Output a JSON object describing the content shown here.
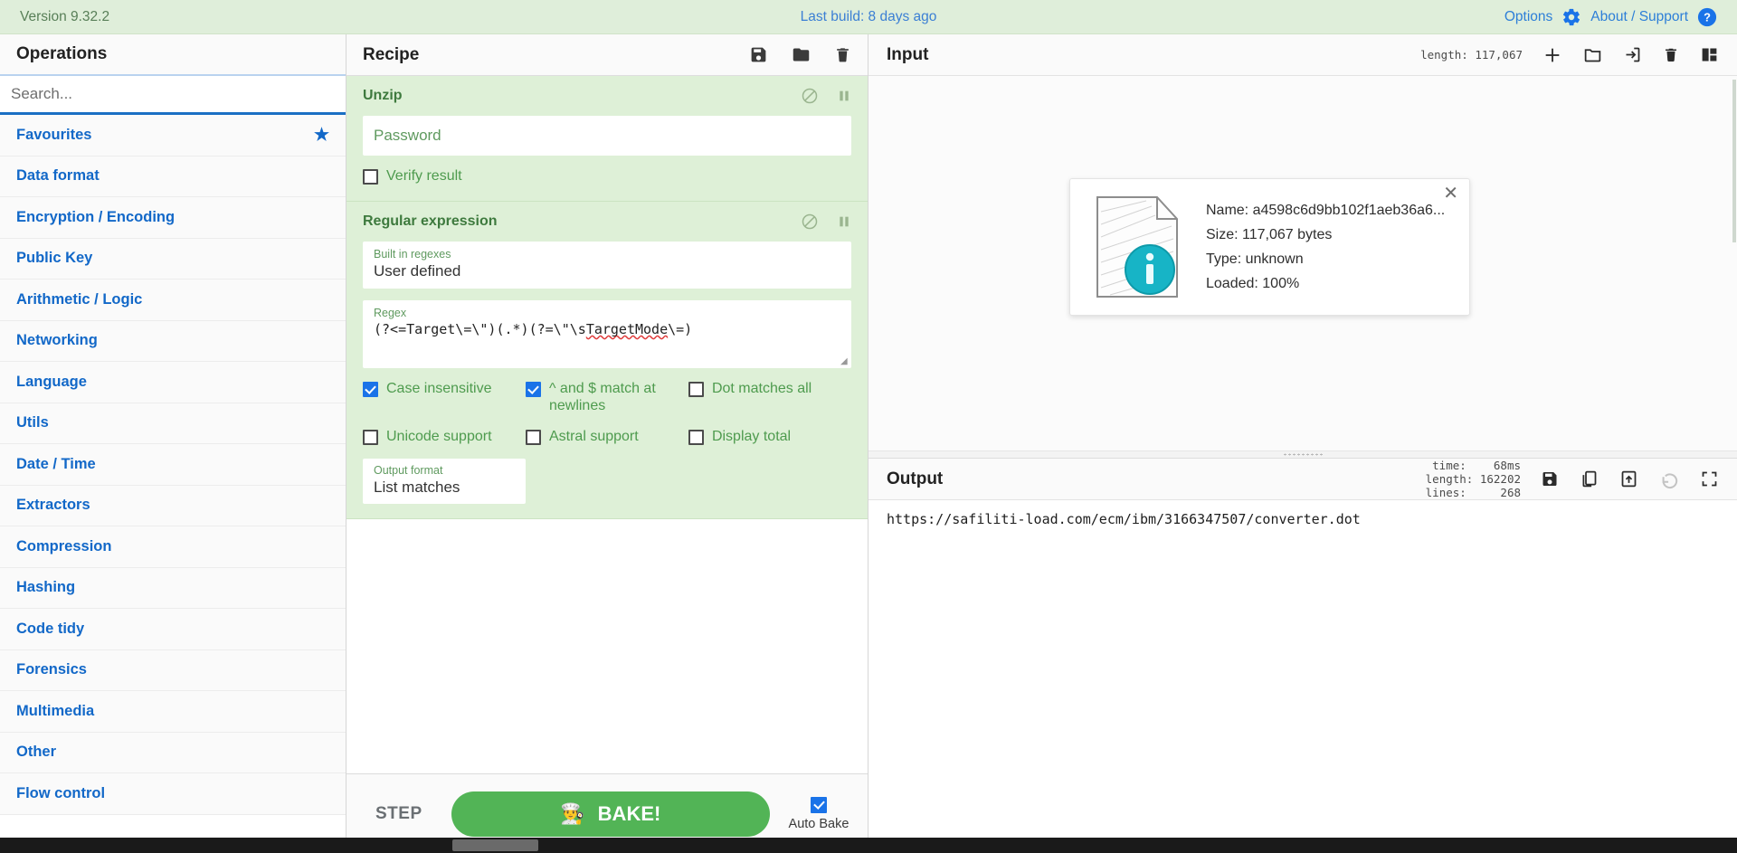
{
  "banner": {
    "version": "Version 9.32.2",
    "last_build": "Last build: 8 days ago",
    "options_label": "Options",
    "about_label": "About / Support",
    "bg_color": "#dfeeda",
    "link_color": "#2d7fd8"
  },
  "operations": {
    "title": "Operations",
    "search_placeholder": "Search...",
    "search_value": "",
    "categories": [
      {
        "label": "Favourites",
        "starred": true
      },
      {
        "label": "Data format",
        "starred": false
      },
      {
        "label": "Encryption / Encoding",
        "starred": false
      },
      {
        "label": "Public Key",
        "starred": false
      },
      {
        "label": "Arithmetic / Logic",
        "starred": false
      },
      {
        "label": "Networking",
        "starred": false
      },
      {
        "label": "Language",
        "starred": false
      },
      {
        "label": "Utils",
        "starred": false
      },
      {
        "label": "Date / Time",
        "starred": false
      },
      {
        "label": "Extractors",
        "starred": false
      },
      {
        "label": "Compression",
        "starred": false
      },
      {
        "label": "Hashing",
        "starred": false
      },
      {
        "label": "Code tidy",
        "starred": false
      },
      {
        "label": "Forensics",
        "starred": false
      },
      {
        "label": "Multimedia",
        "starred": false
      },
      {
        "label": "Other",
        "starred": false
      },
      {
        "label": "Flow control",
        "starred": false
      }
    ]
  },
  "recipe": {
    "title": "Recipe",
    "icons": [
      "save-icon",
      "folder-icon",
      "trash-icon"
    ],
    "op1": {
      "name": "Unzip",
      "password_placeholder": "Password",
      "password_value": "",
      "verify_label": "Verify result",
      "verify_checked": false
    },
    "op2": {
      "name": "Regular expression",
      "builtin_label": "Built in regexes",
      "builtin_value": "User defined",
      "regex_label": "Regex",
      "regex_value": "(?<=Target\\=\\\")(.*)(?=\\\"\\sTargetMode\\=)",
      "regex_plain_head": "(?<=Target\\=\\\")(.*)(?=\\\"\\s",
      "regex_squiggle": "TargetMode",
      "regex_plain_tail": "\\=)",
      "checkboxes": [
        {
          "label": "Case insensitive",
          "checked": true
        },
        {
          "label": "^ and $ match at newlines",
          "checked": true
        },
        {
          "label": "Dot matches all",
          "checked": false
        },
        {
          "label": "Unicode support",
          "checked": false
        },
        {
          "label": "Astral support",
          "checked": false
        },
        {
          "label": "Display total",
          "checked": false
        }
      ],
      "output_format_label": "Output format",
      "output_format_value": "List matches"
    },
    "controls": {
      "step_label": "STEP",
      "bake_label": "BAKE!",
      "bake_icon": "chef-icon",
      "bake_color": "#52b456",
      "autobake_label": "Auto Bake",
      "autobake_checked": true
    }
  },
  "input": {
    "title": "Input",
    "length_label": "length: 117,067",
    "icons": [
      "add-tab-icon",
      "open-folder-icon",
      "open-file-as-input-icon",
      "clear-io-icon",
      "reset-layout-icon"
    ],
    "ghost_text": "                                                     \n",
    "file_card": {
      "name": "Name: a4598c6d9bb102f1aeb36a6...",
      "size": "Size: 117,067 bytes",
      "type": "Type: unknown",
      "loaded": "Loaded: 100%",
      "close_icon": "close-icon",
      "thumb_icon": "file-info-icon"
    }
  },
  "output": {
    "title": "Output",
    "stats": "time:    68ms\nlength: 162202\nlines:     268",
    "stats_time": "time:    68ms",
    "stats_length": "length: 162202",
    "stats_lines": "lines:     268",
    "icons": [
      "save-output-icon",
      "copy-output-icon",
      "replace-input-icon",
      "undo-icon",
      "maximise-icon"
    ],
    "text": "https://safiliti-load.com/ecm/ibm/3166347507/converter.dot"
  }
}
